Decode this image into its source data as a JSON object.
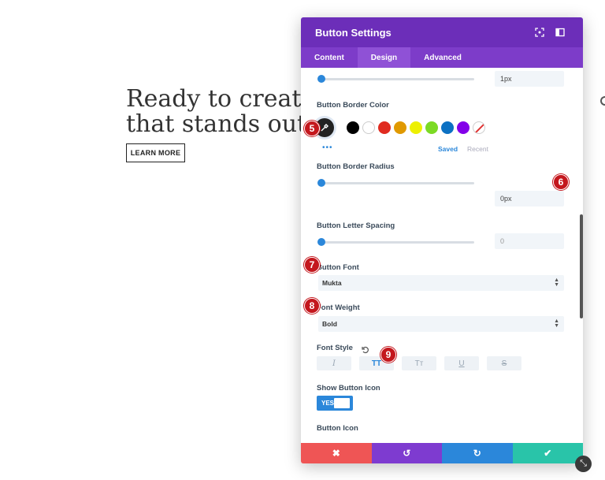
{
  "background": {
    "heading_line1": "Ready to create a",
    "heading_line2": "that stands out fr",
    "cta_label": "LEARN MORE"
  },
  "modal": {
    "title": "Button Settings",
    "tabs": [
      {
        "label": "Content",
        "active": false
      },
      {
        "label": "Design",
        "active": true
      },
      {
        "label": "Advanced",
        "active": false
      }
    ],
    "top_slider_value": "1px",
    "border_color": {
      "label": "Button Border Color",
      "swatches": [
        "#000000",
        "#ffffff",
        "#e02b20",
        "#e09900",
        "#edf000",
        "#7cda24",
        "#0c71c3",
        "#8300e9"
      ],
      "saved_label": "Saved",
      "recent_label": "Recent",
      "more_dots": "•••"
    },
    "border_radius": {
      "label": "Button Border Radius",
      "value": "0px",
      "level": 0
    },
    "letter_spacing": {
      "label": "Button Letter Spacing",
      "value": "0",
      "level": 0
    },
    "font": {
      "label": "Button Font",
      "value": "Mukta"
    },
    "font_weight": {
      "label": "Font Weight",
      "value": "Bold"
    },
    "font_style": {
      "label": "Font Style",
      "options": [
        {
          "glyph": "I",
          "name": "italic",
          "active": false
        },
        {
          "glyph": "TT",
          "name": "uppercase",
          "active": true
        },
        {
          "glyph": "Tт",
          "name": "capitalize",
          "active": false
        },
        {
          "glyph": "U",
          "name": "underline",
          "active": false
        },
        {
          "glyph": "S",
          "name": "strikethrough",
          "active": false
        }
      ]
    },
    "show_icon": {
      "label": "Show Button Icon",
      "value": "YES"
    },
    "button_icon": {
      "label": "Button Icon",
      "icons": [
        "↑",
        "↓",
        "←",
        "→",
        "↖",
        "↗",
        "↘",
        "↙",
        "↕",
        "⇣",
        "↤",
        "↔",
        "↘"
      ]
    },
    "footer": {
      "cancel": "✖",
      "undo": "↺",
      "redo": "↻",
      "save": "✔"
    }
  },
  "badges": [
    "5",
    "6",
    "7",
    "8",
    "9"
  ],
  "colors": {
    "header": "#6c2eb9",
    "tabs": "#7d3cc9",
    "accent": "#2b87da",
    "badge": "#c4171d"
  }
}
